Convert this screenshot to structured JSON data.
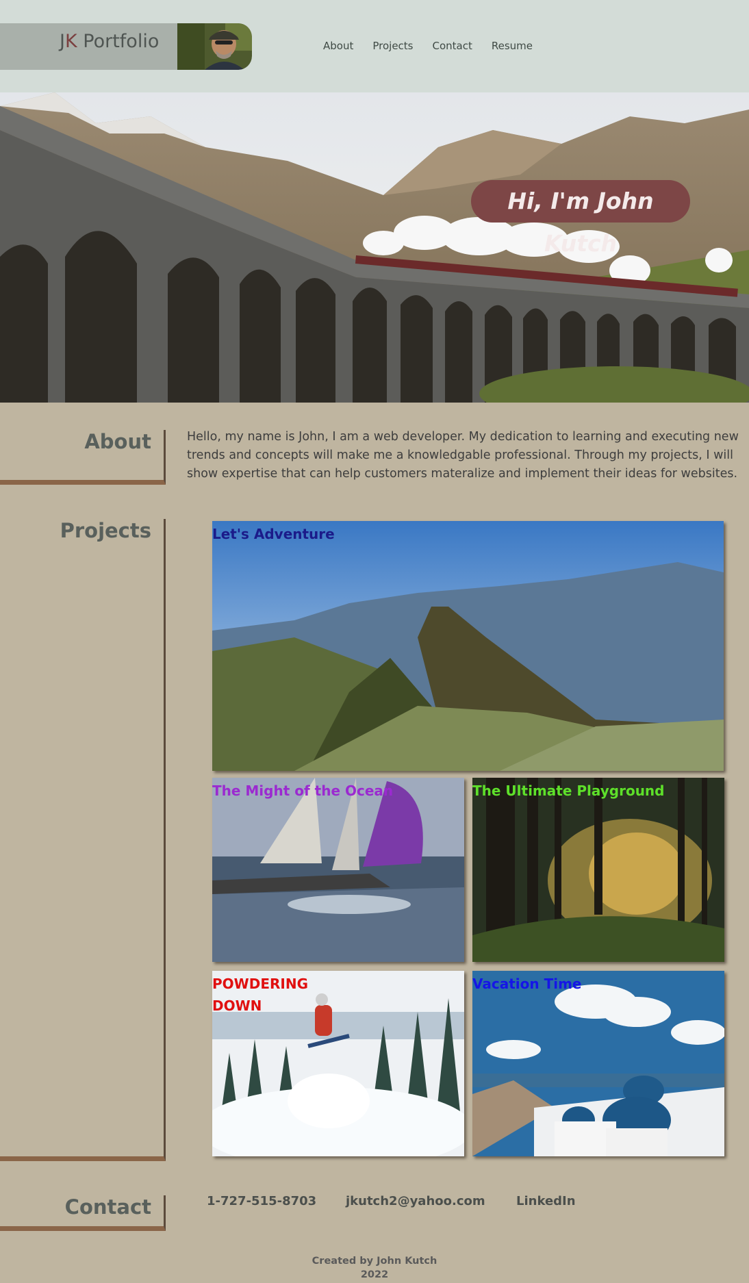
{
  "header": {
    "brand_prefix_j": "J",
    "brand_prefix_k": "K",
    "brand_word": " Portfolio",
    "nav": [
      "About",
      "Projects",
      "Contact",
      "Resume"
    ]
  },
  "hero": {
    "title": "Hi, I'm John Kutch"
  },
  "about": {
    "heading": "About",
    "text": "Hello, my name is John, I am a web developer. My dedication to learning and executing new trends and concepts will make me a knowledgable professional. Through my projects, I will show expertise that can help customers materalize and implement their ideas for websites."
  },
  "projects": {
    "heading": "Projects",
    "items": [
      {
        "label": "Let's Adventure",
        "color": "#1b1b8a"
      },
      {
        "label": "The Might of the Ocean",
        "color": "#9b2ad0"
      },
      {
        "label": "The Ultimate Playground",
        "color": "#5ee02a"
      },
      {
        "label": "POWDERING DOWN",
        "color": "#e01010"
      },
      {
        "label": "Vacation Time",
        "color": "#1515e6"
      }
    ]
  },
  "contact": {
    "heading": "Contact",
    "phone": "1-727-515-8703",
    "email": "jkutch2@yahoo.com",
    "linkedin": "LinkedIn"
  },
  "footer": {
    "line1": "Created by John Kutch",
    "line2": "2022"
  }
}
